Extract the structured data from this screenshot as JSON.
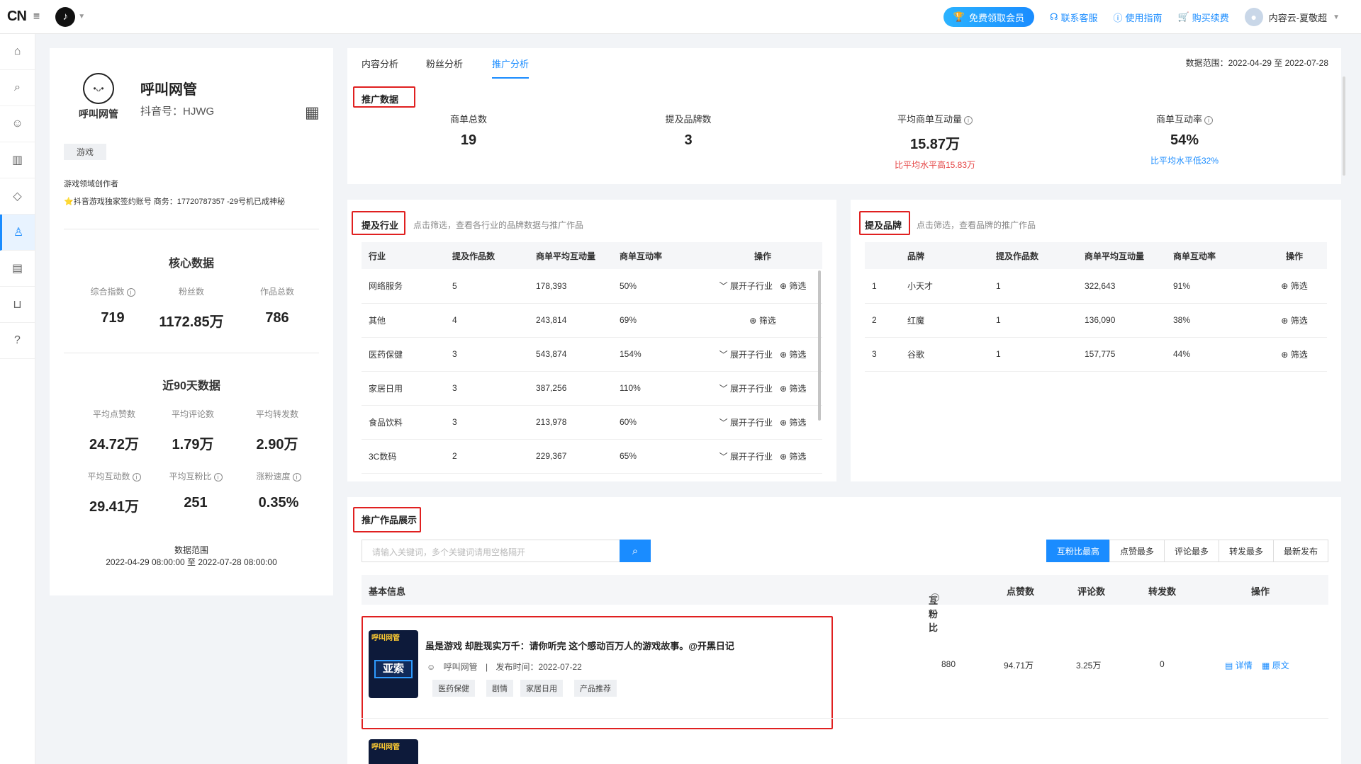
{
  "topbar": {
    "logo": "CN",
    "menu_icon": "hamburger-icon",
    "vip_label": "免费领取会员",
    "service": "联系客服",
    "guide": "使用指南",
    "buy": "购买续费",
    "user": "内容云-夏敬超"
  },
  "sidebar": {
    "icons": [
      "home-icon",
      "search-icon",
      "person-search-icon",
      "chart-icon",
      "diamond-icon",
      "person-icon",
      "note-icon",
      "cart-icon",
      "help-icon"
    ]
  },
  "profile": {
    "avatar_text": "呼叫网管",
    "name": "呼叫网管",
    "douyin_id": "抖音号：HJWG",
    "tag": "游戏",
    "desc1": "游戏领域创作者",
    "desc2": "⭐抖音游戏独家签约账号 商务：17720787357 -29号机已成神秘",
    "core_title": "核心数据",
    "core": [
      {
        "label": "综合指数",
        "value": "719"
      },
      {
        "label": "粉丝数",
        "value": "1172.85万"
      },
      {
        "label": "作品总数",
        "value": "786"
      }
    ],
    "recent_title": "近90天数据",
    "recent": [
      {
        "label": "平均点赞数",
        "value": "24.72万"
      },
      {
        "label": "平均评论数",
        "value": "1.79万"
      },
      {
        "label": "平均转发数",
        "value": "2.90万"
      },
      {
        "label": "平均互动数",
        "value": "29.41万"
      },
      {
        "label": "平均互粉比",
        "value": "251"
      },
      {
        "label": "涨粉速度",
        "value": "0.35%"
      }
    ],
    "range_label": "数据范围",
    "range_value": "2022-04-29 08:00:00 至 2022-07-28 08:00:00"
  },
  "tabs": [
    "内容分析",
    "粉丝分析",
    "推广分析"
  ],
  "active_tab": "推广分析",
  "date_range": "数据范围：2022-04-29 至 2022-07-28",
  "promo": {
    "title": "推广数据",
    "kpis": [
      {
        "label": "商单总数",
        "value": "19",
        "cmp": ""
      },
      {
        "label": "提及品牌数",
        "value": "3",
        "cmp": ""
      },
      {
        "label": "平均商单互动量",
        "value": "15.87万",
        "cmp": "比平均水平高15.83万"
      },
      {
        "label": "商单互动率",
        "value": "54%",
        "cmp": "比平均水平低32%"
      }
    ]
  },
  "industry": {
    "title": "提及行业",
    "hint": "点击筛选，查看各行业的品牌数据与推广作品",
    "headers": [
      "行业",
      "提及作品数",
      "商单平均互动量",
      "商单互动率",
      "操作"
    ],
    "rows": [
      {
        "name": "网络服务",
        "count": "5",
        "avg": "178,393",
        "rate": "50%",
        "expand": "展开子行业",
        "filter": "筛选"
      },
      {
        "name": "其他",
        "count": "4",
        "avg": "243,814",
        "rate": "69%",
        "expand": "",
        "filter": "筛选"
      },
      {
        "name": "医药保健",
        "count": "3",
        "avg": "543,874",
        "rate": "154%",
        "expand": "展开子行业",
        "filter": "筛选"
      },
      {
        "name": "家居日用",
        "count": "3",
        "avg": "387,256",
        "rate": "110%",
        "expand": "展开子行业",
        "filter": "筛选"
      },
      {
        "name": "食品饮料",
        "count": "3",
        "avg": "213,978",
        "rate": "60%",
        "expand": "展开子行业",
        "filter": "筛选"
      },
      {
        "name": "3C数码",
        "count": "2",
        "avg": "229,367",
        "rate": "65%",
        "expand": "展开子行业",
        "filter": "筛选"
      }
    ]
  },
  "brand": {
    "title": "提及品牌",
    "hint": "点击筛选，查看品牌的推广作品",
    "headers": [
      "品牌",
      "提及作品数",
      "商单平均互动量",
      "商单互动率",
      "操作"
    ],
    "rows": [
      {
        "idx": "1",
        "name": "小天才",
        "count": "1",
        "avg": "322,643",
        "rate": "91%",
        "filter": "筛选"
      },
      {
        "idx": "2",
        "name": "红魔",
        "count": "1",
        "avg": "136,090",
        "rate": "38%",
        "filter": "筛选"
      },
      {
        "idx": "3",
        "name": "谷歌",
        "count": "1",
        "avg": "157,775",
        "rate": "44%",
        "filter": "筛选"
      }
    ]
  },
  "works": {
    "title": "推广作品展示",
    "search_placeholder": "请输入关键词，多个关键词请用空格隔开",
    "sorts": [
      "互粉比最高",
      "点赞最多",
      "评论最多",
      "转发最多",
      "最新发布"
    ],
    "headers": [
      "基本信息",
      "互粉比",
      "点赞数",
      "评论数",
      "转发数",
      "操作"
    ],
    "items": [
      {
        "thumb_top": "呼叫网管",
        "thumb_main": "亚索",
        "title": "虽是游戏 却胜现实万千：请你听完 这个感动百万人的游戏故事。@开黑日记",
        "author": "呼叫网管",
        "publish": "发布时间：2022-07-22",
        "tags": [
          "医药保健",
          "剧情",
          "家居日用",
          "产品推荐"
        ],
        "ratio": "880",
        "likes": "94.71万",
        "comments": "3.25万",
        "shares": "0",
        "detail": "详情",
        "origin": "原文"
      },
      {
        "thumb_top": "呼叫网管"
      }
    ]
  }
}
